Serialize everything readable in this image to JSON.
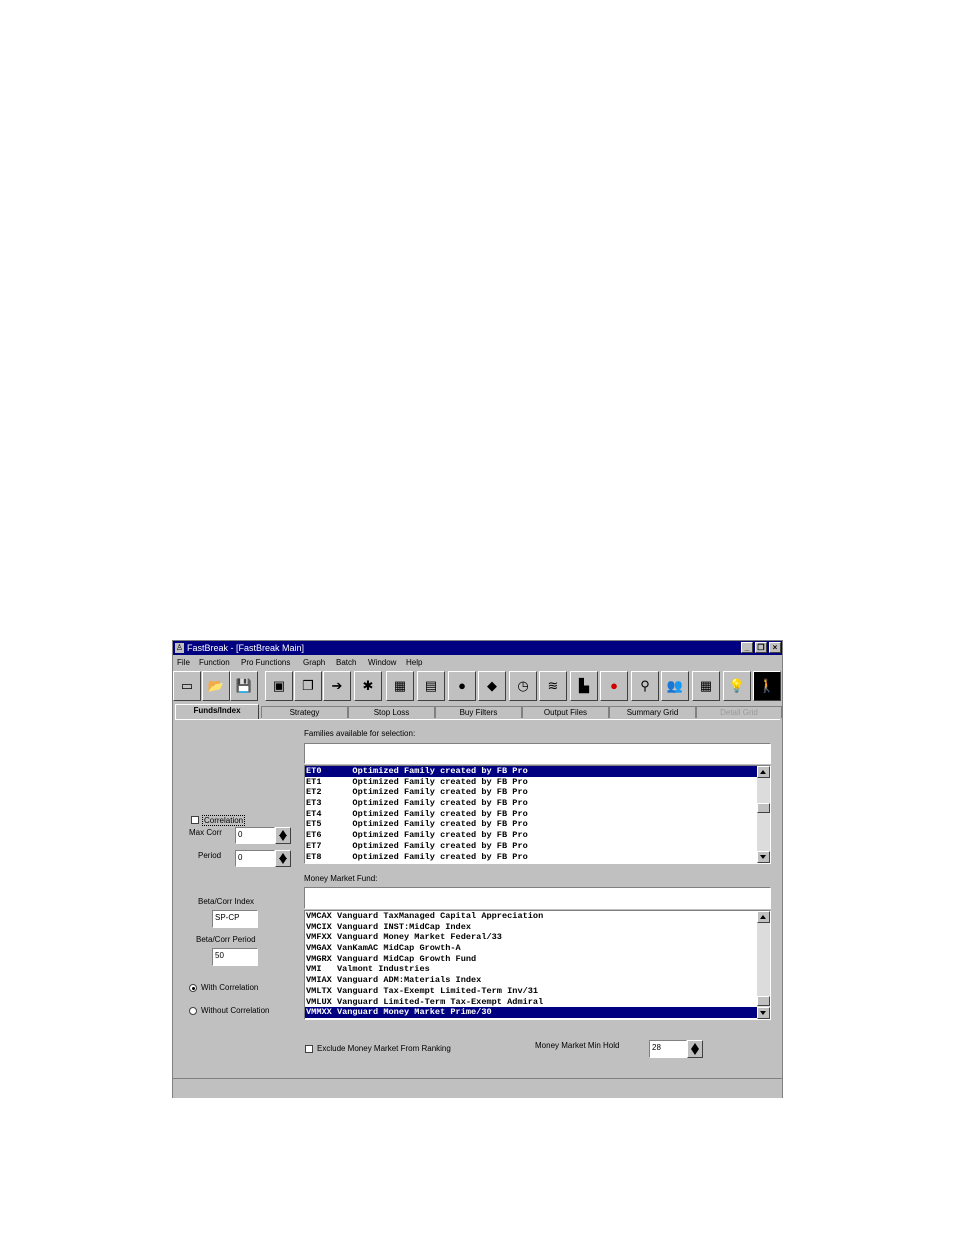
{
  "window": {
    "title": "FastBreak - [FastBreak Main]",
    "min_glyph": "_",
    "restore_glyph": "❐",
    "close_glyph": "×"
  },
  "menu": [
    "File",
    "Function",
    "Pro Functions",
    "Graph",
    "Batch",
    "Window",
    "Help"
  ],
  "toolbar_icons": [
    "new-icon",
    "open-folder-icon",
    "save-disk-icon",
    "book-icon",
    "copy-icon",
    "export-icon",
    "tools-icon",
    "map-icon",
    "chart-doc-icon",
    "color-wheel-icon",
    "diamond-icon",
    "stopwatch-icon",
    "signal-icon",
    "bar-chart-icon",
    "stop-sign-icon",
    "faucet-icon",
    "people-icon",
    "grid-icon",
    "lightbulb-icon",
    "exit-icon"
  ],
  "toolbar_glyphs": [
    "▭",
    "📂",
    "💾",
    "▣",
    "❐",
    "➔",
    "✱",
    "▦",
    "▤",
    "●",
    "◆",
    "◷",
    "≋",
    "▙",
    "●",
    "⚲",
    "👥",
    "▦",
    "💡",
    "🚶"
  ],
  "colors": {
    "selection": "#000080",
    "stop": "#d00000"
  },
  "tabs": [
    "Funds/Index",
    "Strategy",
    "Stop Loss",
    "Buy Filters",
    "Output Files",
    "Summary Grid",
    "Detail Grid"
  ],
  "left": {
    "correlation_label": "Correlation",
    "max_corr_label": "Max Corr",
    "max_corr_value": "0",
    "period_label": "Period",
    "period_value": "0",
    "beta_index_label": "Beta/Corr Index",
    "beta_index_value": "SP-CP",
    "beta_period_label": "Beta/Corr Period",
    "beta_period_value": "50",
    "with_corr_label": "With Correlation",
    "without_corr_label": "Without Correlation"
  },
  "families": {
    "label": "Families available for selection:",
    "filter_value": "",
    "items": [
      "ET0      Optimized Family created by FB Pro",
      "ET1      Optimized Family created by FB Pro",
      "ET2      Optimized Family created by FB Pro",
      "ET3      Optimized Family created by FB Pro",
      "ET4      Optimized Family created by FB Pro",
      "ET5      Optimized Family created by FB Pro",
      "ET6      Optimized Family created by FB Pro",
      "ET7      Optimized Family created by FB Pro",
      "ET8      Optimized Family created by FB Pro"
    ],
    "selected_index": 0
  },
  "money_market": {
    "label": "Money Market Fund:",
    "filter_value": "",
    "items": [
      "VMCAX Vanguard TaxManaged Capital Appreciation",
      "VMCIX Vanguard INST:MidCap Index",
      "VMFXX Vanguard Money Market Federal/33",
      "VMGAX VanKamAC MidCap Growth-A",
      "VMGRX Vanguard MidCap Growth Fund",
      "VMI   Valmont Industries",
      "VMIAX Vanguard ADM:Materials Index",
      "VMLTX Vanguard Tax-Exempt Limited-Term Inv/31",
      "VMLUX Vanguard Limited-Term Tax-Exempt Admiral",
      "VMMXX Vanguard Money Market Prime/30"
    ],
    "selected_index": 9
  },
  "bottom": {
    "exclude_label": "Exclude Money Market From Ranking",
    "min_hold_label": "Money Market Min Hold",
    "min_hold_value": "28"
  }
}
